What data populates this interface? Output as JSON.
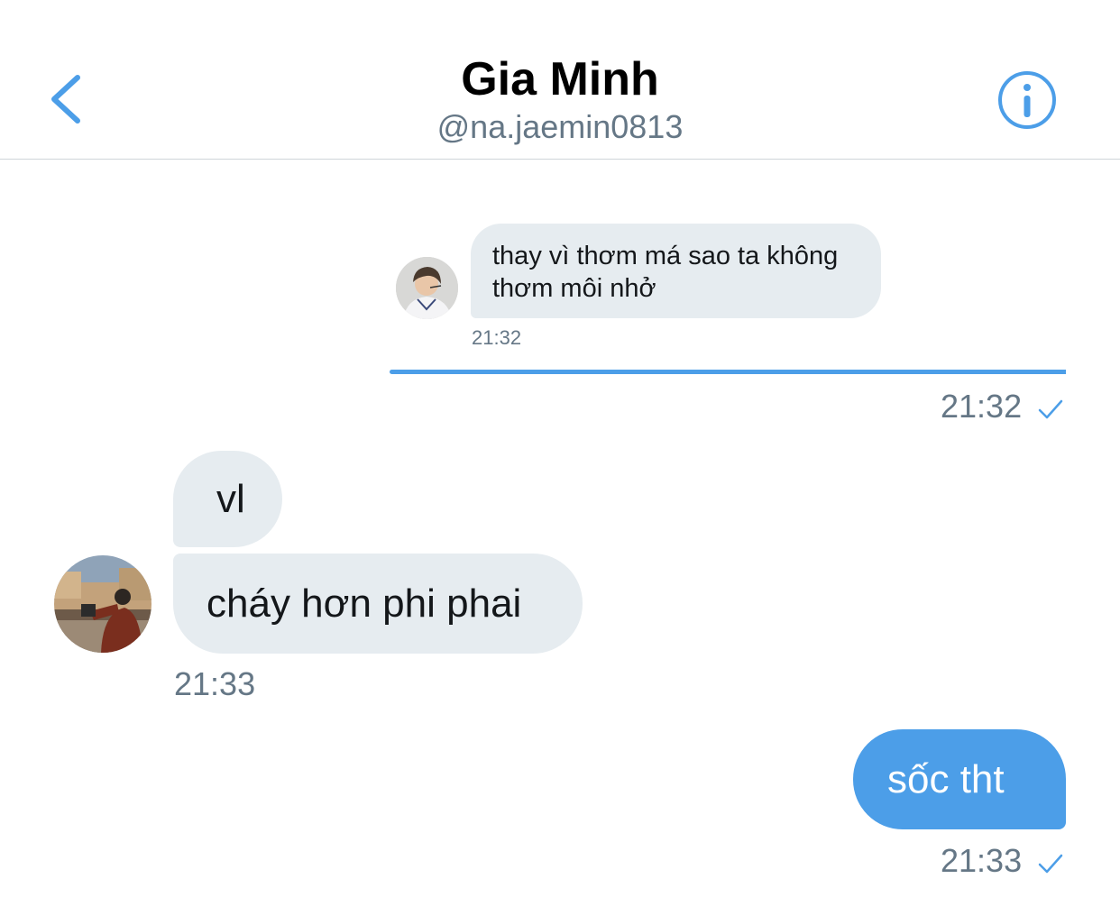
{
  "header": {
    "back_icon": "chevron-left-icon",
    "name": "Gia Minh",
    "handle": "@na.jaemin0813",
    "info_icon": "info-icon"
  },
  "messages": {
    "quoted": {
      "text": "thay vì thơm má sao ta không thơm môi nhở",
      "time": "21:32"
    },
    "sent_1": {
      "time": "21:32",
      "status_icon": "check-icon"
    },
    "received": {
      "bubble_1": "vl",
      "bubble_2": "cháy hơn phi phai",
      "time": "21:33"
    },
    "sent_2": {
      "text": "sốc tht",
      "time": "21:33",
      "status_icon": "check-icon"
    }
  },
  "colors": {
    "accent": "#4c9ee8",
    "bubble_gray": "#e6ecf0",
    "muted_text": "#657786"
  }
}
